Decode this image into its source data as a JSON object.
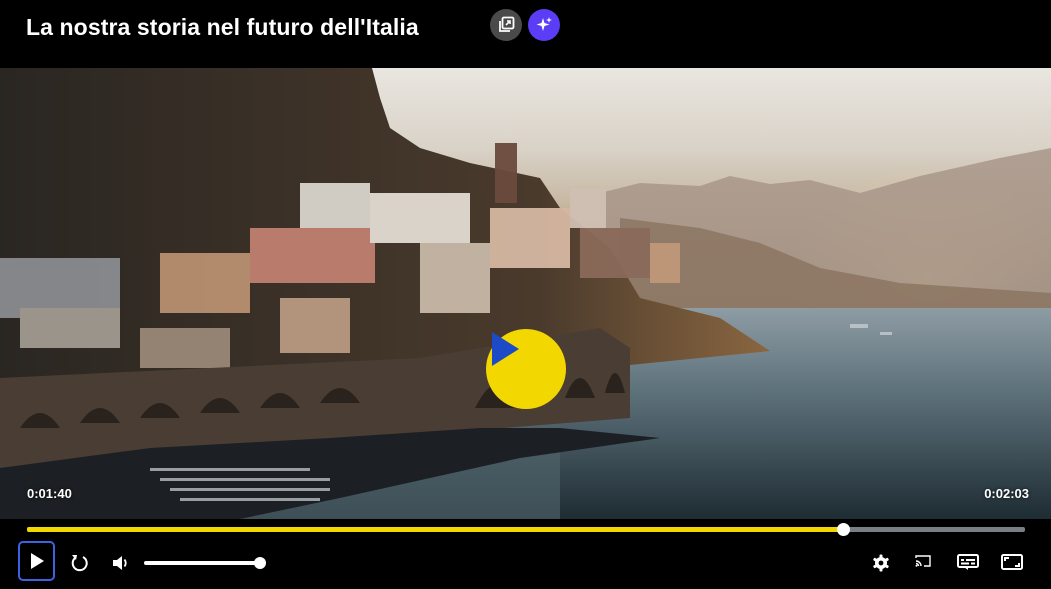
{
  "header": {
    "title": "La nostra storia nel futuro dell'Italia",
    "buttons": [
      {
        "name": "picture-in-picture",
        "icon": "copy-icon"
      },
      {
        "name": "ai-assistant",
        "icon": "sparkles-icon",
        "color": "#5b3df5"
      }
    ]
  },
  "player": {
    "current_time": "0:01:40",
    "duration": "0:02:03",
    "progress": 0.818,
    "volume": 1.0,
    "accent_color": "#f3d700",
    "focus_color": "#3b63e0",
    "controls": [
      "play-icon",
      "replay-icon",
      "volume-icon",
      "gear-icon",
      "cast-icon",
      "subtitles-icon",
      "fullscreen-icon"
    ]
  }
}
